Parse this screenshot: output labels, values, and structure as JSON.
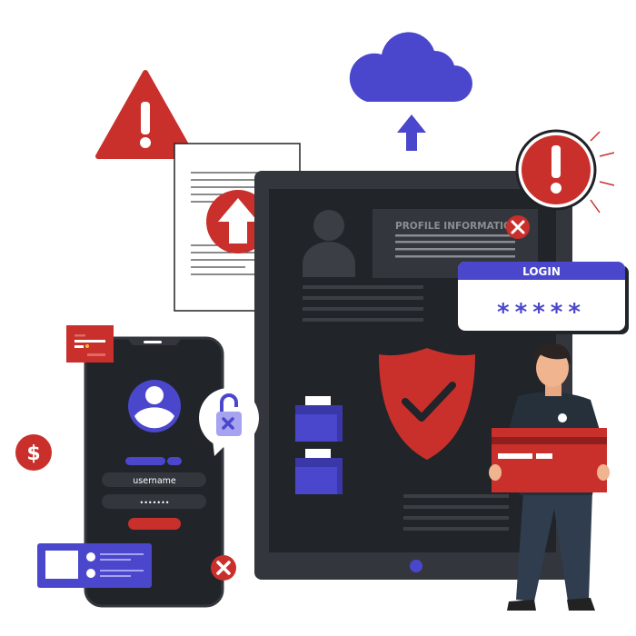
{
  "profile_panel": {
    "title": "PROFILE INFORMATION",
    "close_icon": "x-icon"
  },
  "login_card": {
    "title": "LOGIN",
    "password_mask": "*****"
  },
  "phone": {
    "username_field": "username",
    "password_field": "•••••••",
    "avatar_icon": "user-avatar-icon",
    "lock_icon": "unlocked-padlock-icon"
  },
  "icons": {
    "warning": "warning-triangle-icon",
    "cloud": "cloud-upload-icon",
    "alert": "alert-circle-icon",
    "shield": "shield-check-icon",
    "dollar": "dollar-icon",
    "folders": "folder-icon"
  },
  "colors": {
    "red": "#c9302c",
    "purple": "#4a47cc",
    "dark": "#212428",
    "panel": "#33373d"
  }
}
